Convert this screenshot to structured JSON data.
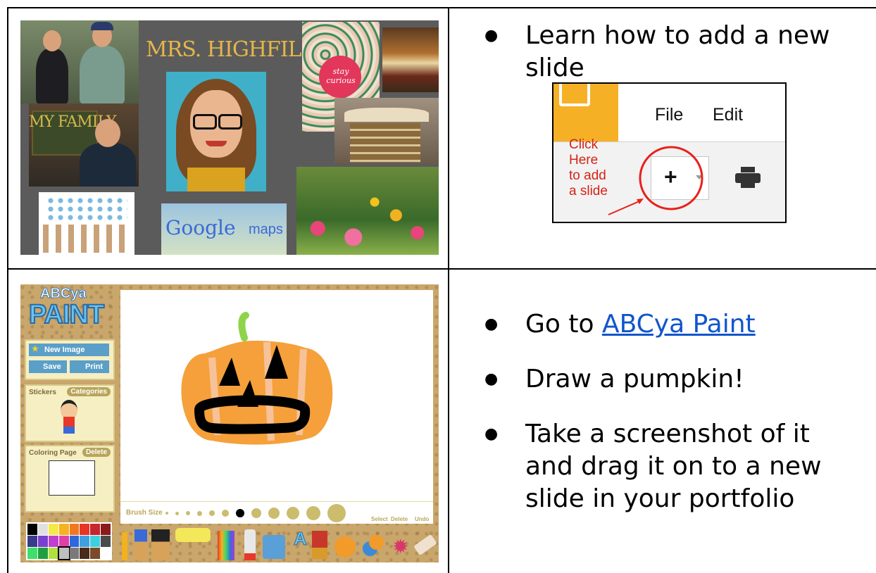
{
  "row1": {
    "bullets": [
      "Learn how to add a new slide"
    ]
  },
  "collage": {
    "teacher_name": "MRS. HIGHFILL",
    "family_label": "MY FAMILY",
    "stay_curious": "stay curious",
    "google_maps_brand": "Google",
    "google_maps_word": "maps"
  },
  "slides_screenshot": {
    "menu_file": "File",
    "menu_edit": "Edit",
    "click_note": [
      "Click",
      "Here",
      "to add",
      "a slide"
    ],
    "add_symbol": "+",
    "accent_color": "#f6b026",
    "callout_color": "#e8201a"
  },
  "row2": {
    "bullet_prefix": "Go to ",
    "bullet_link": "ABCya Paint",
    "bullets": [
      "Draw a pumpkin!",
      "Take a screenshot of it and drag it on to a new slide in your portfolio"
    ]
  },
  "abcya": {
    "logo_top": "ABCya",
    "logo_bottom": "PAINT",
    "new_image": "New Image",
    "save": "Save",
    "print": "Print",
    "stickers": "Stickers",
    "categories": "Categories",
    "coloring_page": "Coloring Page",
    "delete_pill": "Delete",
    "brush_size": "Brush Size",
    "select": "Select",
    "delete": "Delete",
    "undo": "Undo",
    "pumpkin_color": "#f5a03a",
    "palette": [
      "#000000",
      "#e0e0e0",
      "#f4e94b",
      "#f6b21f",
      "#f2781f",
      "#e83526",
      "#c5262f",
      "#8b1a1a",
      "#3a3a8a",
      "#7a3fd0",
      "#c03fd0",
      "#e03fa8",
      "#2f66e0",
      "#3f9fe0",
      "#3fd0e0",
      "#4b4b4b",
      "#3fe06a",
      "#1fa03f",
      "#b0e03f",
      "#c0c0c0",
      "#7a7a7a",
      "#4a2a1a",
      "#7a4a2a",
      "#ffffff"
    ]
  }
}
